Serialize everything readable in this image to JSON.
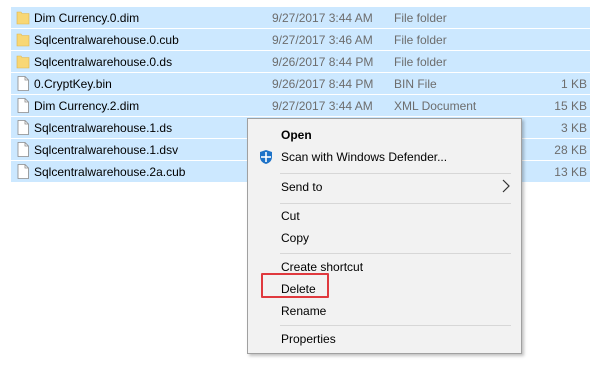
{
  "files": [
    {
      "name": "Dim Currency.0.dim",
      "date": "9/27/2017 3:44 AM",
      "type": "File folder",
      "size": "",
      "icon": "folder-icon",
      "selected": true
    },
    {
      "name": "Sqlcentralwarehouse.0.cub",
      "date": "9/27/2017 3:46 AM",
      "type": "File folder",
      "size": "",
      "icon": "folder-icon",
      "selected": true
    },
    {
      "name": "Sqlcentralwarehouse.0.ds",
      "date": "9/26/2017 8:44 PM",
      "type": "File folder",
      "size": "",
      "icon": "folder-icon",
      "selected": true
    },
    {
      "name": "0.CryptKey.bin",
      "date": "9/26/2017 8:44 PM",
      "type": "BIN File",
      "size": "1 KB",
      "icon": "file-icon",
      "selected": true
    },
    {
      "name": "Dim Currency.2.dim",
      "date": "9/27/2017 3:44 AM",
      "type": "XML Document",
      "size": "15 KB",
      "icon": "file-icon",
      "selected": true
    },
    {
      "name": "Sqlcentralwarehouse.1.ds",
      "date": "",
      "type": "",
      "size": "3 KB",
      "icon": "file-icon",
      "selected": true
    },
    {
      "name": "Sqlcentralwarehouse.1.dsv",
      "date": "",
      "type": "",
      "size": "28 KB",
      "icon": "file-icon",
      "selected": true
    },
    {
      "name": "Sqlcentralwarehouse.2a.cub",
      "date": "",
      "type": "",
      "size": "13 KB",
      "icon": "file-icon",
      "selected": true
    }
  ],
  "context_menu": {
    "open": "Open",
    "scan": "Scan with Windows Defender...",
    "send_to": "Send to",
    "cut": "Cut",
    "copy": "Copy",
    "create_shortcut": "Create shortcut",
    "delete": "Delete",
    "rename": "Rename",
    "properties": "Properties"
  },
  "icons": {
    "defender": "windows-defender-shield-icon",
    "submenu_arrow": "chevron-right-icon"
  },
  "colors": {
    "selection": "#cce8ff",
    "folder": "#f8d775",
    "highlight_border": "#e0393e",
    "menu_bg": "#f2f2f2",
    "defender_blue": "#1e73c8"
  }
}
